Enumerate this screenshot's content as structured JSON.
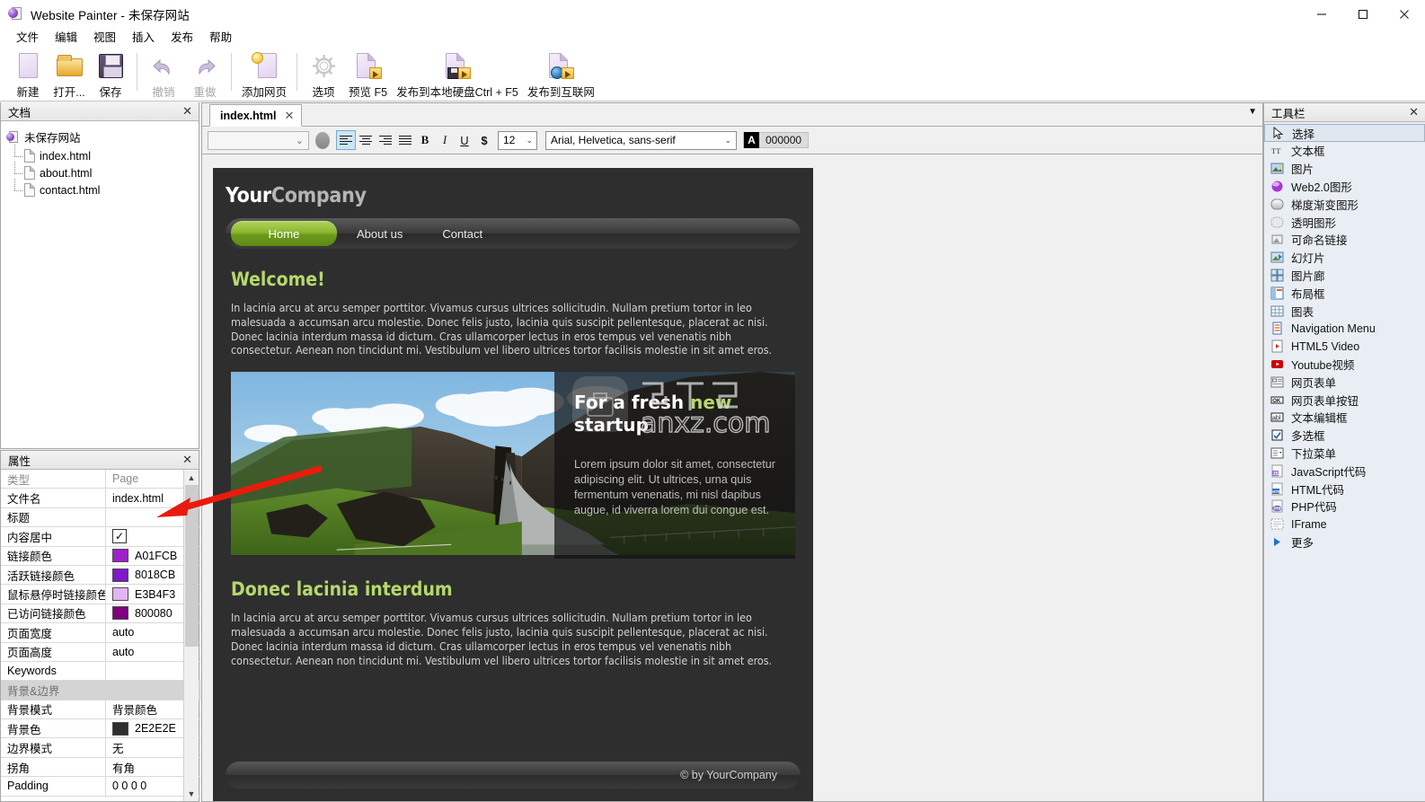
{
  "window": {
    "title": "Website Painter - 未保存网站",
    "app_icon": "website-painter-icon",
    "minimize": "—",
    "maximize": "□",
    "close": "✕"
  },
  "menubar": {
    "items": [
      {
        "label": "文件",
        "name": "menu-file"
      },
      {
        "label": "编辑",
        "name": "menu-edit"
      },
      {
        "label": "视图",
        "name": "menu-view"
      },
      {
        "label": "插入",
        "name": "menu-insert"
      },
      {
        "label": "发布",
        "name": "menu-publish"
      },
      {
        "label": "帮助",
        "name": "menu-help"
      }
    ]
  },
  "toolbar": {
    "buttons": [
      {
        "label": "新建",
        "icon": "new-page-icon",
        "disabled": false
      },
      {
        "label": "打开...",
        "icon": "open-folder-icon",
        "disabled": false
      },
      {
        "label": "保存",
        "icon": "save-floppy-icon",
        "disabled": false
      },
      {
        "label": "撤销",
        "icon": "undo-arrow-icon",
        "disabled": true
      },
      {
        "label": "重做",
        "icon": "redo-arrow-icon",
        "disabled": true
      },
      {
        "label": "添加网页",
        "icon": "add-page-icon",
        "disabled": false
      },
      {
        "label": "选项",
        "icon": "gear-options-icon",
        "disabled": false
      },
      {
        "label": "预览 F5",
        "icon": "preview-page-icon",
        "disabled": false
      },
      {
        "label": "发布到本地硬盘Ctrl + F5",
        "icon": "publish-local-icon",
        "disabled": false
      },
      {
        "label": "发布到互联网",
        "icon": "publish-internet-icon",
        "disabled": false
      }
    ]
  },
  "documents_panel": {
    "title": "文档",
    "close": "✕",
    "root": "未保存网站",
    "files": [
      "index.html",
      "about.html",
      "contact.html"
    ]
  },
  "properties_panel": {
    "title": "属性",
    "close": "✕",
    "col_key": "类型",
    "col_value": "Page",
    "rows": [
      {
        "key": "文件名",
        "value": "index.html",
        "type": "text"
      },
      {
        "key": "标题",
        "value": "",
        "type": "text"
      },
      {
        "key": "内容居中",
        "value": "✓",
        "type": "checkbox"
      },
      {
        "key": "链接颜色",
        "value": "A01FCB",
        "type": "color",
        "color": "#A01FCB"
      },
      {
        "key": "活跃链接颜色",
        "value": "8018CB",
        "type": "color",
        "color": "#8018CB"
      },
      {
        "key": "鼠标悬停时链接颜色",
        "value": "E3B4F3",
        "type": "color",
        "color": "#E3B4F3"
      },
      {
        "key": "已访问链接颜色",
        "value": "800080",
        "type": "color",
        "color": "#800080"
      },
      {
        "key": "页面宽度",
        "value": "auto",
        "type": "text"
      },
      {
        "key": "页面高度",
        "value": "auto",
        "type": "text"
      },
      {
        "key": "Keywords",
        "value": "",
        "type": "text"
      },
      {
        "key": "背景&边界",
        "value": "",
        "type": "section"
      },
      {
        "key": "背景模式",
        "value": "背景颜色",
        "type": "text"
      },
      {
        "key": "背景色",
        "value": "2E2E2E",
        "type": "color",
        "color": "#2E2E2E"
      },
      {
        "key": "边界模式",
        "value": "无",
        "type": "text"
      },
      {
        "key": "拐角",
        "value": "有角",
        "type": "text"
      },
      {
        "key": "Padding",
        "value": "0 0 0 0",
        "type": "text"
      }
    ]
  },
  "editor": {
    "tab": {
      "label": "index.html",
      "close": "✕"
    },
    "collapse_icon": "chevron-down-icon",
    "format_bar": {
      "style_select_value": "",
      "font_size": "12",
      "font_family": "Arial, Helvetica, sans-serif",
      "text_color_hex": "000000",
      "color_swatch_letter": "A",
      "bold": "B",
      "italic": "I",
      "underline": "U",
      "strike_dollar": "$",
      "align_left": "align-left-icon",
      "align_center": "align-center-icon",
      "align_right": "align-right-icon",
      "align_justify": "align-justify-icon",
      "active_align": "align-left"
    }
  },
  "site_preview": {
    "brand_part1": "Your",
    "brand_part2": "Company",
    "nav": [
      {
        "label": "Home",
        "active": true
      },
      {
        "label": "About us",
        "active": false
      },
      {
        "label": "Contact",
        "active": false
      }
    ],
    "heading1": "Welcome!",
    "paragraph1": "In lacinia arcu at arcu semper porttitor. Vivamus cursus ultrices sollicitudin. Nullam pretium tortor in leo malesuada a accumsan arcu molestie. Donec felis justo, lacinia quis suscipit pellentesque, placerat ac nisi. Donec lacinia interdum massa id dictum. Cras ullamcorper lectus in eros tempus vel venenatis nibh consectetur. Aenean non tincidunt mi. Vestibulum vel libero ultrices tortor facilisis molestie in sit amet eros.",
    "hero": {
      "image_alt": "rift-valley-landscape-photo",
      "headline_plain": "For a fresh ",
      "headline_accent": "new",
      "headline_line2": "startup",
      "text": "Lorem ipsum dolor sit amet, consectetur adipiscing elit. Ut ultrices, urna quis fermentum venenatis, mi nisl dapibus augue, id viverra lorem dui congue est."
    },
    "heading2": "Donec lacinia interdum",
    "paragraph2": "In lacinia arcu at arcu semper porttitor. Vivamus cursus ultrices sollicitudin. Nullam pretium tortor in leo malesuada a accumsan arcu molestie. Donec felis justo, lacinia quis suscipit pellentesque, placerat ac nisi. Donec lacinia interdum massa id dictum. Cras ullamcorper lectus in eros tempus vel venenatis nibh consectetur. Aenean non tincidunt mi. Vestibulum vel libero ultrices tortor facilisis molestie in sit amet eros.",
    "footer": "© by YourCompany",
    "watermark": "anxz.com",
    "accent_green": "#b5d96b",
    "background": "#2E2E2E"
  },
  "toolbox": {
    "title": "工具栏",
    "close": "✕",
    "items": [
      {
        "label": "选择",
        "icon": "cursor-arrow-icon",
        "selected": true
      },
      {
        "label": "文本框",
        "icon": "textbox-icon",
        "selected": false
      },
      {
        "label": "图片",
        "icon": "image-icon",
        "selected": false
      },
      {
        "label": "Web2.0图形",
        "icon": "web20-shape-icon",
        "selected": false
      },
      {
        "label": "梯度渐变图形",
        "icon": "gradient-shape-icon",
        "selected": false
      },
      {
        "label": "透明图形",
        "icon": "transparent-shape-icon",
        "selected": false
      },
      {
        "label": "可命名链接",
        "icon": "named-anchor-icon",
        "selected": false
      },
      {
        "label": "幻灯片",
        "icon": "slideshow-icon",
        "selected": false
      },
      {
        "label": "图片廊",
        "icon": "image-gallery-icon",
        "selected": false
      },
      {
        "label": "布局框",
        "icon": "layout-box-icon",
        "selected": false
      },
      {
        "label": "图表",
        "icon": "table-icon",
        "selected": false
      },
      {
        "label": "Navigation Menu",
        "icon": "navigation-menu-icon",
        "selected": false
      },
      {
        "label": "HTML5 Video",
        "icon": "html5-video-icon",
        "selected": false
      },
      {
        "label": "Youtube视频",
        "icon": "youtube-icon",
        "selected": false
      },
      {
        "label": "网页表单",
        "icon": "web-form-icon",
        "selected": false
      },
      {
        "label": "网页表单按钮",
        "icon": "form-button-icon",
        "selected": false
      },
      {
        "label": "文本编辑框",
        "icon": "text-input-icon",
        "selected": false
      },
      {
        "label": "多选框",
        "icon": "checkbox-icon",
        "selected": false
      },
      {
        "label": "下拉菜单",
        "icon": "dropdown-icon",
        "selected": false
      },
      {
        "label": "JavaScript代码",
        "icon": "javascript-code-icon",
        "selected": false
      },
      {
        "label": "HTML代码",
        "icon": "html-code-icon",
        "selected": false
      },
      {
        "label": "PHP代码",
        "icon": "php-code-icon",
        "selected": false
      },
      {
        "label": "IFrame",
        "icon": "iframe-icon",
        "selected": false
      },
      {
        "label": "更多",
        "icon": "more-triangle-icon",
        "selected": false
      }
    ]
  },
  "annotation": {
    "arrow": "red-pointer-arrow"
  }
}
